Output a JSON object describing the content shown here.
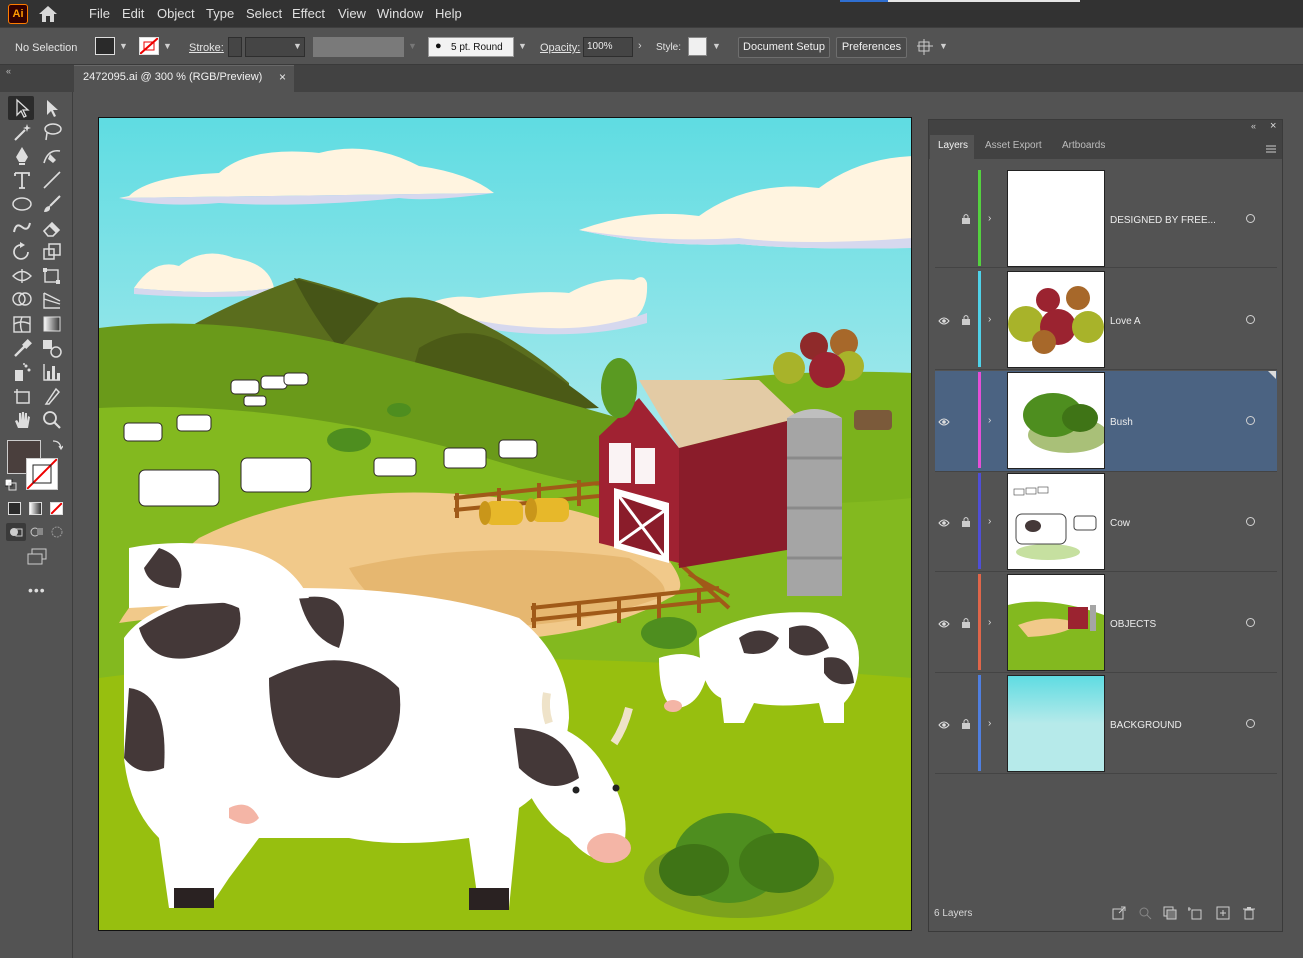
{
  "app": {
    "logo": "Ai"
  },
  "menu": [
    "File",
    "Edit",
    "Object",
    "Type",
    "Select",
    "Effect",
    "View",
    "Window",
    "Help"
  ],
  "controlbar": {
    "selection_status": "No Selection",
    "stroke_label": "Stroke:",
    "brush_value": "5 pt. Round",
    "opacity_label": "Opacity:",
    "opacity_value": "100%",
    "style_label": "Style:",
    "document_setup_label": "Document Setup",
    "preferences_label": "Preferences"
  },
  "document_tab": {
    "label": "2472095.ai @ 300 % (RGB/Preview)",
    "close": "×"
  },
  "colors": {
    "fill": "#4a3f3d",
    "accent_blue": "#2f6fd1",
    "selected_row": "#4b6382"
  },
  "panel": {
    "tabs": [
      "Layers",
      "Asset Export",
      "Artboards"
    ],
    "collapse_glyph": "«",
    "close_glyph": "×",
    "layers_count": "6 Layers"
  },
  "layers": [
    {
      "name": "DESIGNED BY FREE...",
      "color": "#54d13f",
      "eye": false,
      "selected": false
    },
    {
      "name": "Love A",
      "color": "#4fd2e9",
      "eye": true,
      "selected": false
    },
    {
      "name": "Bush",
      "color": "#e54fd7",
      "eye": true,
      "selected": true
    },
    {
      "name": "Cow",
      "color": "#4f4fd6",
      "eye": true,
      "selected": false
    },
    {
      "name": "OBJECTS",
      "color": "#e0664a",
      "eye": true,
      "selected": false
    },
    {
      "name": "BACKGROUND",
      "color": "#4f7fe0",
      "eye": true,
      "selected": false
    }
  ],
  "icons": {
    "toolbox": [
      "selection-tool-icon",
      "direct-selection-tool-icon",
      "magic-wand-icon",
      "lasso-icon",
      "pen-tool-icon",
      "curvature-tool-icon",
      "type-tool-icon",
      "line-tool-icon",
      "ellipse-tool-icon",
      "paintbrush-icon",
      "shaper-tool-icon",
      "eraser-icon",
      "rotate-tool-icon",
      "scale-tool-icon",
      "width-tool-icon",
      "free-transform-icon",
      "shape-builder-icon",
      "perspective-grid-icon",
      "mesh-tool-icon",
      "gradient-tool-icon",
      "eyedropper-icon",
      "blend-tool-icon",
      "symbol-sprayer-icon",
      "column-graph-icon",
      "artboard-tool-icon",
      "slice-tool-icon",
      "hand-tool-icon",
      "zoom-tool-icon"
    ]
  }
}
